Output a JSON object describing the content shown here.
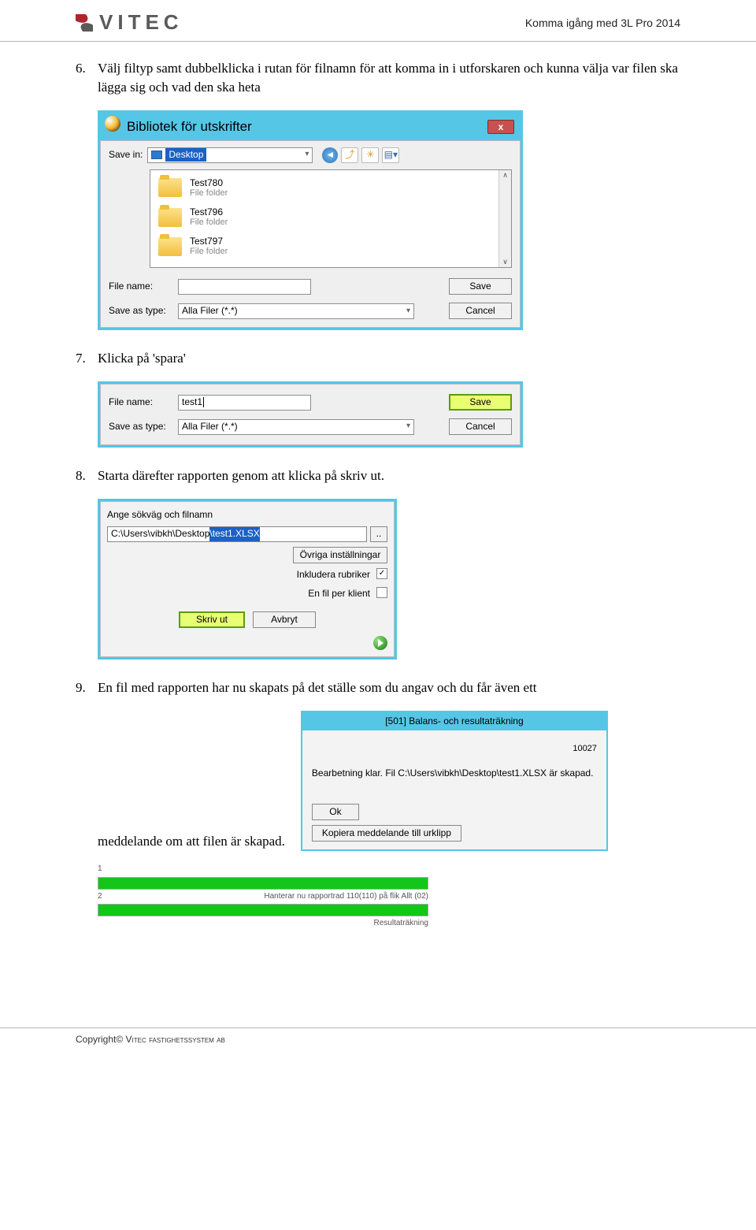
{
  "header": {
    "doc_title": "Komma igång med 3L Pro 2014",
    "brand": "VITEC"
  },
  "steps": {
    "s6": {
      "num": "6.",
      "text": "Välj filtyp samt dubbelklicka i rutan för filnamn för att komma in i utforskaren och kunna välja var filen ska lägga sig och vad den ska heta"
    },
    "s7": {
      "num": "7.",
      "text": "Klicka på 'spara'"
    },
    "s8": {
      "num": "8.",
      "text": "Starta därefter rapporten genom att klicka på skriv ut."
    },
    "s9": {
      "num": "9.",
      "text": "En fil med rapporten har nu skapats på det ställe som du angav och du får  även ett",
      "tail": "meddelande om att filen är skapad."
    }
  },
  "dlg1": {
    "title": "Bibliotek för utskrifter",
    "save_in_label": "Save in:",
    "save_in_value": "Desktop",
    "folders": [
      {
        "name": "Test780",
        "sub": "File folder"
      },
      {
        "name": "Test796",
        "sub": "File folder"
      },
      {
        "name": "Test797",
        "sub": "File folder"
      }
    ],
    "file_name_label": "File name:",
    "file_name_value": "",
    "save_as_type_label": "Save as type:",
    "save_as_type_value": "Alla Filer (*.*)",
    "btn_save": "Save",
    "btn_cancel": "Cancel"
  },
  "dlg2": {
    "file_name_label": "File name:",
    "file_name_value": "test1",
    "save_as_type_label": "Save as type:",
    "save_as_type_value": "Alla Filer (*.*)",
    "btn_save": "Save",
    "btn_cancel": "Cancel"
  },
  "dlg3": {
    "caption": "Ange sökväg och filnamn",
    "path_prefix": "C:\\Users\\vibkh\\Desktop",
    "path_sel": "\\test1.XLSX",
    "btn_browse": "..",
    "btn_other": "Övriga inställningar",
    "lbl_include": "Inkludera rubriker",
    "lbl_perclient": "En fil per klient",
    "btn_print": "Skriv ut",
    "btn_cancel": "Avbryt"
  },
  "msg": {
    "title": "[501]  Balans- och resultaträkning",
    "id": "10027",
    "body": "Bearbetning klar. Fil  C:\\Users\\vibkh\\Desktop\\test1.XLSX är skapad.",
    "ok": "Ok",
    "copy": "Kopiera meddelande till urklipp"
  },
  "prog": {
    "row1_l": "1",
    "row2_l": "2",
    "status": "Hanterar nu rapportrad 110(110) på flik Allt (02)",
    "right": "Resultaträkning"
  },
  "footer": {
    "text_a": "Copyright© ",
    "text_b": "Vitec fastighetssystem ab"
  }
}
